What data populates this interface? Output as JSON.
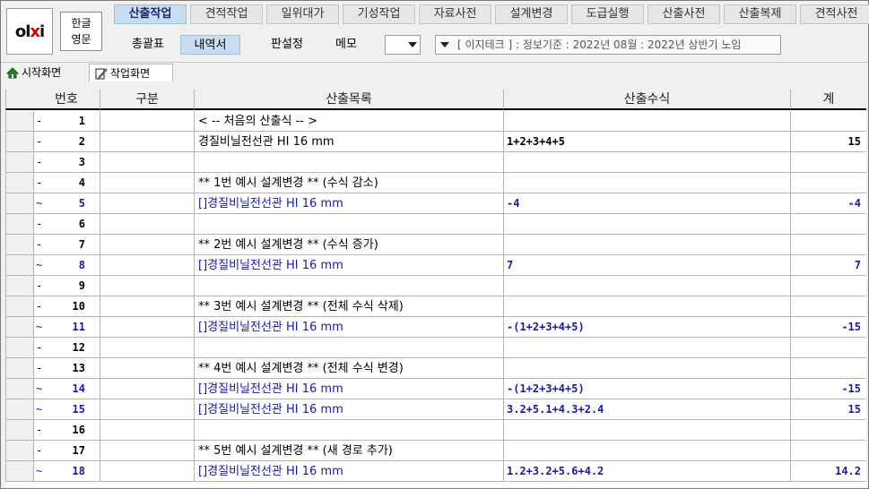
{
  "logo": {
    "text_left": "ol",
    "text_mid": "x",
    "text_right": "i"
  },
  "lang": {
    "korean": "한글",
    "english": "영문"
  },
  "tabs": [
    {
      "label": "산출작업",
      "active": true
    },
    {
      "label": "견적작업"
    },
    {
      "label": "일위대가"
    },
    {
      "label": "기성작업"
    },
    {
      "label": "자료사전"
    },
    {
      "label": "설계변경"
    },
    {
      "label": "도급실행"
    },
    {
      "label": "산출사전"
    },
    {
      "label": "산출복제"
    },
    {
      "label": "견적사전"
    }
  ],
  "subtabs": {
    "summary": "총괄표",
    "detail": "내역서",
    "settings": "판설정",
    "memo": "메모"
  },
  "info_combo": "[ 이지테크 ] : 정보기준 : 2022년 08월 : 2022년 상반기 노임",
  "nav": {
    "home": "시작화면",
    "work": "작업화면"
  },
  "columns": [
    "번호",
    "구분",
    "산출목록",
    "산출수식",
    "계"
  ],
  "rows": [
    {
      "mark": "-",
      "no": "1",
      "name": "< -- 처음의 산출식 -- >",
      "formula": "",
      "total": "",
      "blue": false
    },
    {
      "mark": "-",
      "no": "2",
      "name": "경질비닐전선관 HI 16 mm",
      "formula": "1+2+3+4+5",
      "total": "15",
      "blue": false
    },
    {
      "mark": "-",
      "no": "3",
      "name": "",
      "formula": "",
      "total": "",
      "blue": false
    },
    {
      "mark": "-",
      "no": "4",
      "name": "** 1번 예시 설계변경 ** (수식 감소)",
      "formula": "",
      "total": "",
      "blue": false
    },
    {
      "mark": "~",
      "no": "5",
      "name": "[]경질비닐전선관 HI 16 mm",
      "formula": "-4",
      "total": "-4",
      "blue": true
    },
    {
      "mark": "-",
      "no": "6",
      "name": "",
      "formula": "",
      "total": "",
      "blue": false
    },
    {
      "mark": "-",
      "no": "7",
      "name": "** 2번 예시 설계변경 ** (수식 증가)",
      "formula": "",
      "total": "",
      "blue": false
    },
    {
      "mark": "~",
      "no": "8",
      "name": "[]경질비닐전선관 HI 16 mm",
      "formula": "7",
      "total": "7",
      "blue": true
    },
    {
      "mark": "-",
      "no": "9",
      "name": "",
      "formula": "",
      "total": "",
      "blue": false
    },
    {
      "mark": "-",
      "no": "10",
      "name": "** 3번 예시 설계변경 ** (전체 수식 삭제)",
      "formula": "",
      "total": "",
      "blue": false
    },
    {
      "mark": "~",
      "no": "11",
      "name": "[]경질비닐전선관 HI 16 mm",
      "formula": "-(1+2+3+4+5)",
      "total": "-15",
      "blue": true
    },
    {
      "mark": "-",
      "no": "12",
      "name": "",
      "formula": "",
      "total": "",
      "blue": false
    },
    {
      "mark": "-",
      "no": "13",
      "name": "** 4번 예시 설계변경 ** (전체 수식 변경)",
      "formula": "",
      "total": "",
      "blue": false
    },
    {
      "mark": "~",
      "no": "14",
      "name": "[]경질비닐전선관 HI 16 mm",
      "formula": "-(1+2+3+4+5)",
      "total": "-15",
      "blue": true
    },
    {
      "mark": "~",
      "no": "15",
      "name": "[]경질비닐전선관 HI 16 mm",
      "formula": "3.2+5.1+4.3+2.4",
      "total": "15",
      "blue": true
    },
    {
      "mark": "-",
      "no": "16",
      "name": "",
      "formula": "",
      "total": "",
      "blue": false
    },
    {
      "mark": "-",
      "no": "17",
      "name": "** 5번 예시 설계변경 ** (새 경로 추가)",
      "formula": "",
      "total": "",
      "blue": false
    },
    {
      "mark": "~",
      "no": "18",
      "name": "[]경질비닐전선관 HI 16 mm",
      "formula": "1.2+3.2+5.6+4.2",
      "total": "14.2",
      "blue": true
    }
  ]
}
